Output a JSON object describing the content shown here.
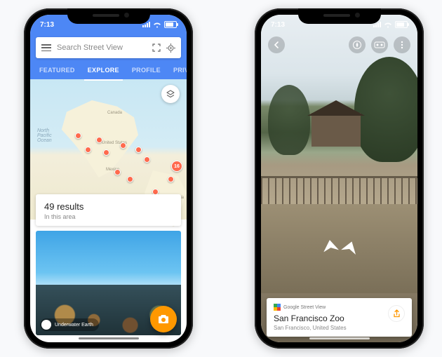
{
  "status": {
    "time": "7:13"
  },
  "left": {
    "search": {
      "placeholder": "Search Street View"
    },
    "tabs": [
      "FEATURED",
      "EXPLORE",
      "PROFILE",
      "PRIVATE"
    ],
    "active_tab": "EXPLORE",
    "map_labels": {
      "ocean": "North\nPacific\nOcean",
      "countries": [
        "Canada",
        "United States",
        "Mexico",
        "Venezuela"
      ]
    },
    "cluster_badge": "16",
    "results": {
      "title": "49 results",
      "subtitle": "In this area"
    },
    "photo_credit": "Underwater Earth"
  },
  "right": {
    "card": {
      "app_name": "Google Street View",
      "title": "San Francisco Zoo",
      "location": "San Francisco, United States"
    }
  }
}
